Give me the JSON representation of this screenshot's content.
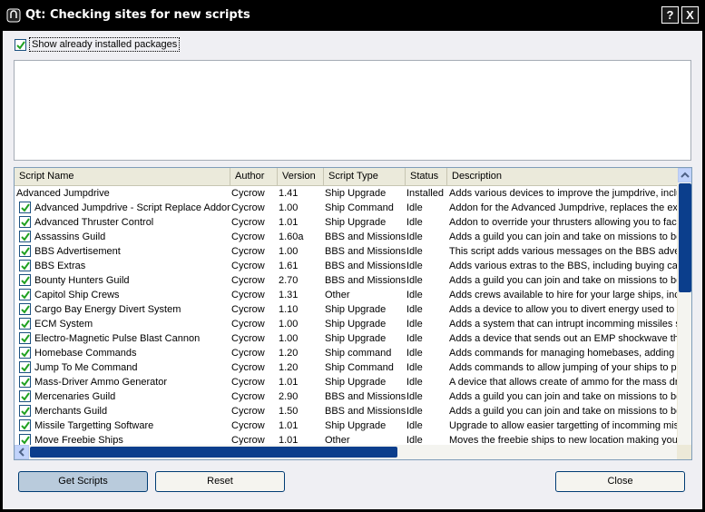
{
  "window": {
    "title": "Qt: Checking sites for new scripts",
    "help_label": "?",
    "close_label": "X"
  },
  "options": {
    "show_installed_label": "Show already installed packages",
    "show_installed_checked": true
  },
  "table": {
    "columns": [
      "Script Name",
      "Author",
      "Version",
      "Script Type",
      "Status",
      "Description"
    ],
    "rows": [
      {
        "checked": false,
        "name": "Advanced Jumpdrive",
        "author": "Cycrow",
        "version": "1.41",
        "type": "Ship Upgrade",
        "status": "Installed",
        "description": "Adds various devices to improve the jumpdrive, includ"
      },
      {
        "checked": true,
        "name": "Advanced Jumpdrive - Script Replace Addon",
        "author": "Cycrow",
        "version": "1.00",
        "type": "Ship Command",
        "status": "Idle",
        "description": "Addon for the Advanced Jumpdrive, replaces the exis"
      },
      {
        "checked": true,
        "name": "Advanced Thruster Control",
        "author": "Cycrow",
        "version": "1.01",
        "type": "Ship Upgrade",
        "status": "Idle",
        "description": "Addon to override your thrusters allowing you to face i"
      },
      {
        "checked": true,
        "name": "Assassins Guild",
        "author": "Cycrow",
        "version": "1.60a",
        "type": "BBS and Missions",
        "status": "Idle",
        "description": "Adds a guild you can join and take on missions to bec"
      },
      {
        "checked": true,
        "name": "BBS Advertisement",
        "author": "Cycrow",
        "version": "1.00",
        "type": "BBS and Missions",
        "status": "Idle",
        "description": "This script adds various messages on the BBS advert"
      },
      {
        "checked": true,
        "name": "BBS Extras",
        "author": "Cycrow",
        "version": "1.61",
        "type": "BBS and Missions",
        "status": "Idle",
        "description": "Adds various extras to the BBS, including buying capt"
      },
      {
        "checked": true,
        "name": "Bounty Hunters Guild",
        "author": "Cycrow",
        "version": "2.70",
        "type": "BBS and Missions",
        "status": "Idle",
        "description": "Adds a guild you can join and take on missions to bec"
      },
      {
        "checked": true,
        "name": "Capitol Ship Crews",
        "author": "Cycrow",
        "version": "1.31",
        "type": "Other",
        "status": "Idle",
        "description": "Adds crews available to hire for your large ships, inclu"
      },
      {
        "checked": true,
        "name": "Cargo Bay Energy Divert System",
        "author": "Cycrow",
        "version": "1.10",
        "type": "Ship Upgrade",
        "status": "Idle",
        "description": "Adds a device to allow you to divert energy used to e"
      },
      {
        "checked": true,
        "name": "ECM System",
        "author": "Cycrow",
        "version": "1.00",
        "type": "Ship Upgrade",
        "status": "Idle",
        "description": "Adds a system that can intrupt incomming missiles sys"
      },
      {
        "checked": true,
        "name": "Electro-Magnetic Pulse Blast Cannon",
        "author": "Cycrow",
        "version": "1.00",
        "type": "Ship Upgrade",
        "status": "Idle",
        "description": "Adds a device that sends out an EMP shockwave tha"
      },
      {
        "checked": true,
        "name": "Homebase Commands",
        "author": "Cycrow",
        "version": "1.20",
        "type": "Ship command",
        "status": "Idle",
        "description": "Adds commands for managing homebases, adding an"
      },
      {
        "checked": true,
        "name": "Jump To Me Command",
        "author": "Cycrow",
        "version": "1.20",
        "type": "Ship Command",
        "status": "Idle",
        "description": "Adds commands to allow jumping of your ships to prot"
      },
      {
        "checked": true,
        "name": "Mass-Driver Ammo Generator",
        "author": "Cycrow",
        "version": "1.01",
        "type": "Ship Upgrade",
        "status": "Idle",
        "description": "A device that allows create of ammo for the mass driv"
      },
      {
        "checked": true,
        "name": "Mercenaries Guild",
        "author": "Cycrow",
        "version": "2.90",
        "type": "BBS and Missions",
        "status": "Idle",
        "description": "Adds a guild you can join and take on missions to bec"
      },
      {
        "checked": true,
        "name": "Merchants Guild",
        "author": "Cycrow",
        "version": "1.50",
        "type": "BBS and Missions",
        "status": "Idle",
        "description": "Adds a guild you can join and take on missions to bec"
      },
      {
        "checked": true,
        "name": "Missile Targetting Software",
        "author": "Cycrow",
        "version": "1.01",
        "type": "Ship Upgrade",
        "status": "Idle",
        "description": "Upgrade to allow easier targetting of incomming missil"
      },
      {
        "checked": true,
        "name": "Move Freebie Ships",
        "author": "Cycrow",
        "version": "1.01",
        "type": "Other",
        "status": "Idle",
        "description": "Moves the freebie ships to new location making you h"
      }
    ]
  },
  "buttons": {
    "get_scripts": "Get Scripts",
    "reset": "Reset",
    "close": "Close"
  },
  "colors": {
    "titlebar": "#000000",
    "client_bg": "#efeff3",
    "scroll_thumb": "#0b3e8c",
    "check_mark": "#21a121"
  }
}
